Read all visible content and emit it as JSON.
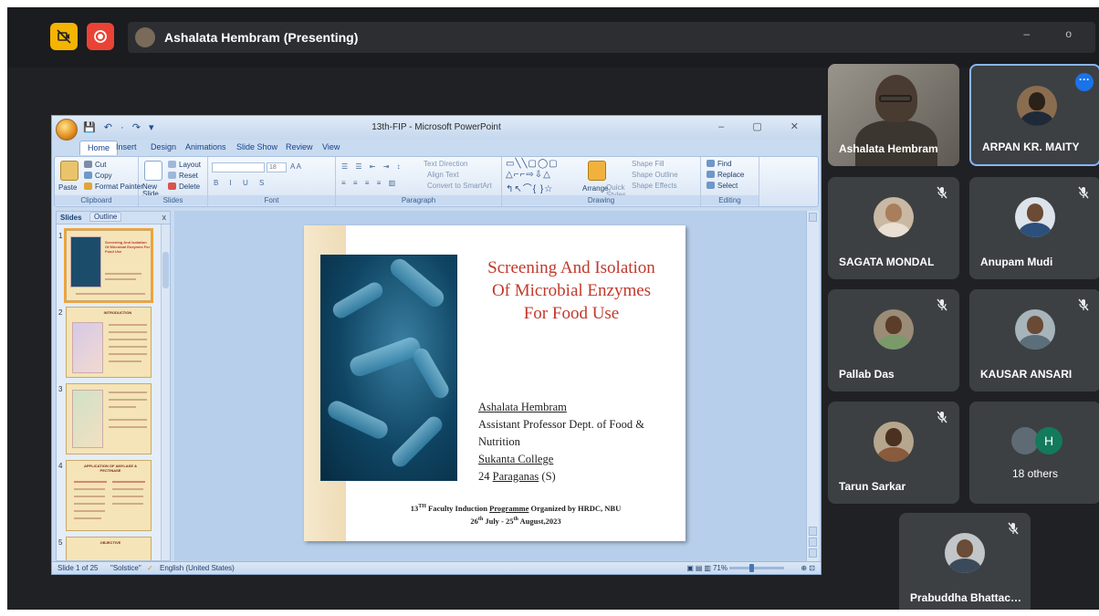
{
  "meet": {
    "presenter_label": "Ashalata Hembram (Presenting)",
    "window_controls": "– o"
  },
  "ppt": {
    "quick_access": "💾 ↶ · ↷ ▾",
    "window_title": "13th-FIP - Microsoft PowerPoint",
    "window_buttons": "– ▢ ✕",
    "tabs": [
      "Home",
      "Insert",
      "Design",
      "Animations",
      "Slide Show",
      "Review",
      "View"
    ],
    "ribbon": {
      "clipboard": {
        "paste": "Paste",
        "cut": "Cut",
        "copy": "Copy",
        "format_painter": "Format Painter",
        "label": "Clipboard"
      },
      "slides": {
        "new_slide": "New Slide",
        "layout": "Layout",
        "reset": "Reset",
        "delete": "Delete",
        "label": "Slides"
      },
      "font": {
        "size": "18",
        "label": "Font"
      },
      "paragraph": {
        "text_direction": "Text Direction",
        "align_text": "Align Text",
        "convert_smartart": "Convert to SmartArt",
        "label": "Paragraph"
      },
      "drawing": {
        "arrange": "Arrange",
        "quick_styles": "Quick Styles",
        "shape_fill": "Shape Fill",
        "shape_outline": "Shape Outline",
        "shape_effects": "Shape Effects",
        "label": "Drawing"
      },
      "editing": {
        "find": "Find",
        "replace": "Replace",
        "select": "Select",
        "label": "Editing"
      }
    },
    "panel": {
      "slides_tab": "Slides",
      "outline_tab": "Outline",
      "close": "x"
    },
    "thumbnails": [
      {
        "num": "1",
        "title": "Screening And Isolation Of Microbial Enzymes For Food Use"
      },
      {
        "num": "2",
        "title": "INTRODUCTION"
      },
      {
        "num": "3",
        "title": ""
      },
      {
        "num": "4",
        "title": "APPLICATION OF AMYLASE & PECTINASE"
      },
      {
        "num": "5",
        "title": "OBJECTIVE"
      }
    ],
    "slide": {
      "title_lines": [
        "Screening And Isolation",
        "Of Microbial Enzymes",
        "For Food Use"
      ],
      "author_name": "Ashalata Hembram",
      "author_role": "Assistant Professor Dept. of Food & Nutrition",
      "college": "Sukanta College",
      "place_prefix": "24 ",
      "place_underlined": "Paraganas",
      "place_suffix": " (S)",
      "footer_line1_prefix": "13",
      "footer_line1_sup": "TH",
      "footer_line1_pre": " Faculty Induction ",
      "footer_line1_ul": "Programme",
      "footer_line1_post": " Organized by HRDC, NBU",
      "footer_line2_a": "26",
      "footer_line2_sup1": "th",
      "footer_line2_b": " July - 25",
      "footer_line2_sup2": "th",
      "footer_line2_c": " August,2023"
    },
    "status": {
      "slide_of": "Slide 1 of 25",
      "theme": "\"Solstice\"",
      "language": "English (United States)",
      "zoom": "71%"
    }
  },
  "participants": [
    {
      "name": "Ashalata Hembram"
    },
    {
      "name": "ARPAN KR. MAITY"
    },
    {
      "name": "SAGATA MONDAL"
    },
    {
      "name": "Anupam Mudi"
    },
    {
      "name": "Pallab Das"
    },
    {
      "name": "KAUSAR ANSARI"
    },
    {
      "name": "Tarun Sarkar"
    },
    {
      "name": "Prabuddha Bhattacha..."
    }
  ],
  "others": {
    "initial": "H",
    "label": "18 others"
  },
  "colors": {
    "meet_bg": "#202124",
    "tile_bg": "#3c4043",
    "slide_title": "#c0392b",
    "notice": "#f5b400",
    "record": "#ea4335",
    "active_border": "#8ab4f8"
  }
}
